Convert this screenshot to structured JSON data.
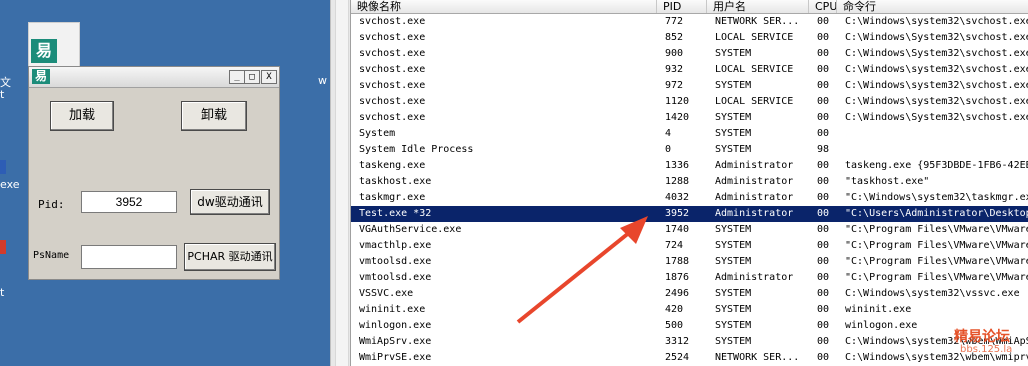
{
  "desktop": {
    "edge_texts": [
      "文",
      "t",
      "exe",
      "t"
    ],
    "w_letter": "w"
  },
  "app": {
    "load_label": "加载",
    "unload_label": "卸载",
    "pid_label": "Pid:",
    "pid_value": "3952",
    "dw_button": "dw驱动通讯",
    "psname_label": "PsName",
    "psname_value": "",
    "pchar_button": "PCHAR 驱动通讯",
    "title_buttons": [
      "_",
      "□",
      "X"
    ]
  },
  "task_manager": {
    "columns": [
      "映像名称",
      "PID",
      "用户名",
      "CPU",
      "命令行"
    ],
    "rows": [
      {
        "name": "svchost.exe",
        "pid": "772",
        "user": "NETWORK SER...",
        "cpu": "00",
        "cmd": "C:\\Windows\\system32\\svchost.exe"
      },
      {
        "name": "svchost.exe",
        "pid": "852",
        "user": "LOCAL SERVICE",
        "cpu": "00",
        "cmd": "C:\\Windows\\System32\\svchost.exe"
      },
      {
        "name": "svchost.exe",
        "pid": "900",
        "user": "SYSTEM",
        "cpu": "00",
        "cmd": "C:\\Windows\\System32\\svchost.exe"
      },
      {
        "name": "svchost.exe",
        "pid": "932",
        "user": "LOCAL SERVICE",
        "cpu": "00",
        "cmd": "C:\\Windows\\system32\\svchost.exe"
      },
      {
        "name": "svchost.exe",
        "pid": "972",
        "user": "SYSTEM",
        "cpu": "00",
        "cmd": "C:\\Windows\\system32\\svchost.exe"
      },
      {
        "name": "svchost.exe",
        "pid": "1120",
        "user": "LOCAL SERVICE",
        "cpu": "00",
        "cmd": "C:\\Windows\\system32\\svchost.exe"
      },
      {
        "name": "svchost.exe",
        "pid": "1420",
        "user": "SYSTEM",
        "cpu": "00",
        "cmd": "C:\\Windows\\System32\\svchost.exe"
      },
      {
        "name": "System",
        "pid": "4",
        "user": "SYSTEM",
        "cpu": "00",
        "cmd": ""
      },
      {
        "name": "System Idle Process",
        "pid": "0",
        "user": "SYSTEM",
        "cpu": "98",
        "cmd": ""
      },
      {
        "name": "taskeng.exe",
        "pid": "1336",
        "user": "Administrator",
        "cpu": "00",
        "cmd": "taskeng.exe {95F3DBDE-1FB6-42EB"
      },
      {
        "name": "taskhost.exe",
        "pid": "1288",
        "user": "Administrator",
        "cpu": "00",
        "cmd": "\"taskhost.exe\""
      },
      {
        "name": "taskmgr.exe",
        "pid": "4032",
        "user": "Administrator",
        "cpu": "00",
        "cmd": "\"C:\\Windows\\system32\\taskmgr.exe"
      },
      {
        "name": "Test.exe *32",
        "pid": "3952",
        "user": "Administrator",
        "cpu": "00",
        "cmd": "\"C:\\Users\\Administrator\\Desktop"
      },
      {
        "name": "VGAuthService.exe",
        "pid": "1740",
        "user": "SYSTEM",
        "cpu": "00",
        "cmd": "\"C:\\Program Files\\VMware\\VMware"
      },
      {
        "name": "vmacthlp.exe",
        "pid": "724",
        "user": "SYSTEM",
        "cpu": "00",
        "cmd": "\"C:\\Program Files\\VMware\\VMware"
      },
      {
        "name": "vmtoolsd.exe",
        "pid": "1788",
        "user": "SYSTEM",
        "cpu": "00",
        "cmd": "\"C:\\Program Files\\VMware\\VMware"
      },
      {
        "name": "vmtoolsd.exe",
        "pid": "1876",
        "user": "Administrator",
        "cpu": "00",
        "cmd": "\"C:\\Program Files\\VMware\\VMware"
      },
      {
        "name": "VSSVC.exe",
        "pid": "2496",
        "user": "SYSTEM",
        "cpu": "00",
        "cmd": "C:\\Windows\\system32\\vssvc.exe"
      },
      {
        "name": "wininit.exe",
        "pid": "420",
        "user": "SYSTEM",
        "cpu": "00",
        "cmd": "wininit.exe"
      },
      {
        "name": "winlogon.exe",
        "pid": "500",
        "user": "SYSTEM",
        "cpu": "00",
        "cmd": "winlogon.exe"
      },
      {
        "name": "WmiApSrv.exe",
        "pid": "3312",
        "user": "SYSTEM",
        "cpu": "00",
        "cmd": "C:\\Windows\\system32\\wbem\\WmiApS"
      },
      {
        "name": "WmiPrvSE.exe",
        "pid": "2524",
        "user": "NETWORK SER...",
        "cpu": "00",
        "cmd": "C:\\Windows\\system32\\wbem\\wmiprv"
      }
    ],
    "selected_index": 12
  },
  "watermark": {
    "line1": "精易论坛",
    "line2": "bbs.125.la"
  },
  "colors": {
    "selection": "#0a246a",
    "arrow": "#e8462c",
    "desktop": "#3b6ea8"
  }
}
